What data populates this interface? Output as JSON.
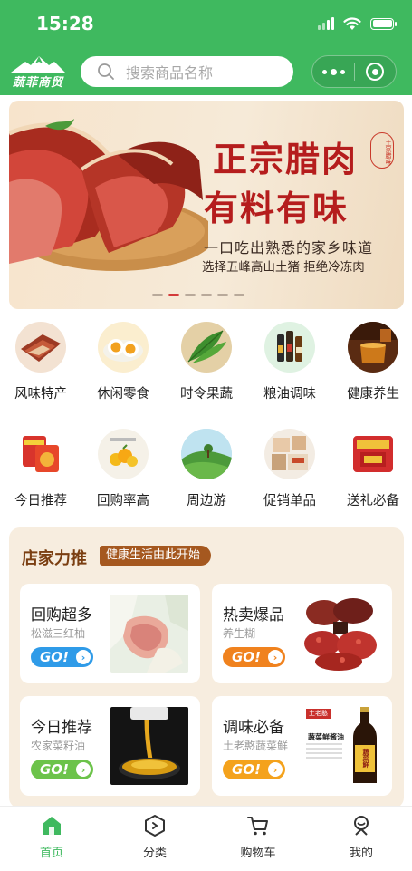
{
  "status_bar": {
    "time": "15:28"
  },
  "header": {
    "logo_text": "蔬菲商贸",
    "search_placeholder": "搜索商品名称",
    "accent_color": "#3fb95f"
  },
  "banner": {
    "title_line1": "正宗腊肉",
    "title_line2": "有料有味",
    "seal_text": "土家腊味",
    "subtitle_line1": "一口吃出熟悉的家乡味道",
    "subtitle_line2": "选择五峰高山土猪  拒绝冷冻肉",
    "page_count": 6,
    "active_page": 2
  },
  "categories": [
    {
      "label": "风味特产",
      "icon": "cured-meat-icon"
    },
    {
      "label": "休闲零食",
      "icon": "salted-egg-icon"
    },
    {
      "label": "时令果蔬",
      "icon": "vegetable-icon"
    },
    {
      "label": "粮油调味",
      "icon": "oil-bottles-icon"
    },
    {
      "label": "健康养生",
      "icon": "honey-icon"
    },
    {
      "label": "今日推荐",
      "icon": "snack-pack-icon"
    },
    {
      "label": "回购率高",
      "icon": "orange-icon"
    },
    {
      "label": "周边游",
      "icon": "landscape-icon"
    },
    {
      "label": "促销单品",
      "icon": "gift-box-icon"
    },
    {
      "label": "送礼必备",
      "icon": "gift-bag-icon"
    }
  ],
  "shop": {
    "title": "店家力推",
    "tag": "健康生活由此开始",
    "go_label": "GO!",
    "cards": [
      {
        "title": "回购超多",
        "subtitle": "松滋三红柚",
        "go_color": "#2f9be8",
        "image": "pomelo-image"
      },
      {
        "title": "热卖爆品",
        "subtitle": "养生糊",
        "go_color": "#f0821e",
        "image": "red-beans-image"
      },
      {
        "title": "今日推荐",
        "subtitle": "农家菜籽油",
        "go_color": "#6cc34a",
        "image": "rapeseed-oil-image"
      },
      {
        "title": "调味必备",
        "subtitle": "土老憨蔬菜鲜",
        "go_color": "#f4a21c",
        "image": "soy-sauce-image"
      }
    ],
    "soy_label_brand": "土老憨",
    "soy_label_name": "蔬菜鲜酱油",
    "soy_bottle_text": "蔬菜鲜"
  },
  "tabbar": [
    {
      "label": "首页",
      "icon": "home-icon",
      "active": true
    },
    {
      "label": "分类",
      "icon": "category-icon",
      "active": false
    },
    {
      "label": "购物车",
      "icon": "cart-icon",
      "active": false
    },
    {
      "label": "我的",
      "icon": "profile-icon",
      "active": false
    }
  ]
}
